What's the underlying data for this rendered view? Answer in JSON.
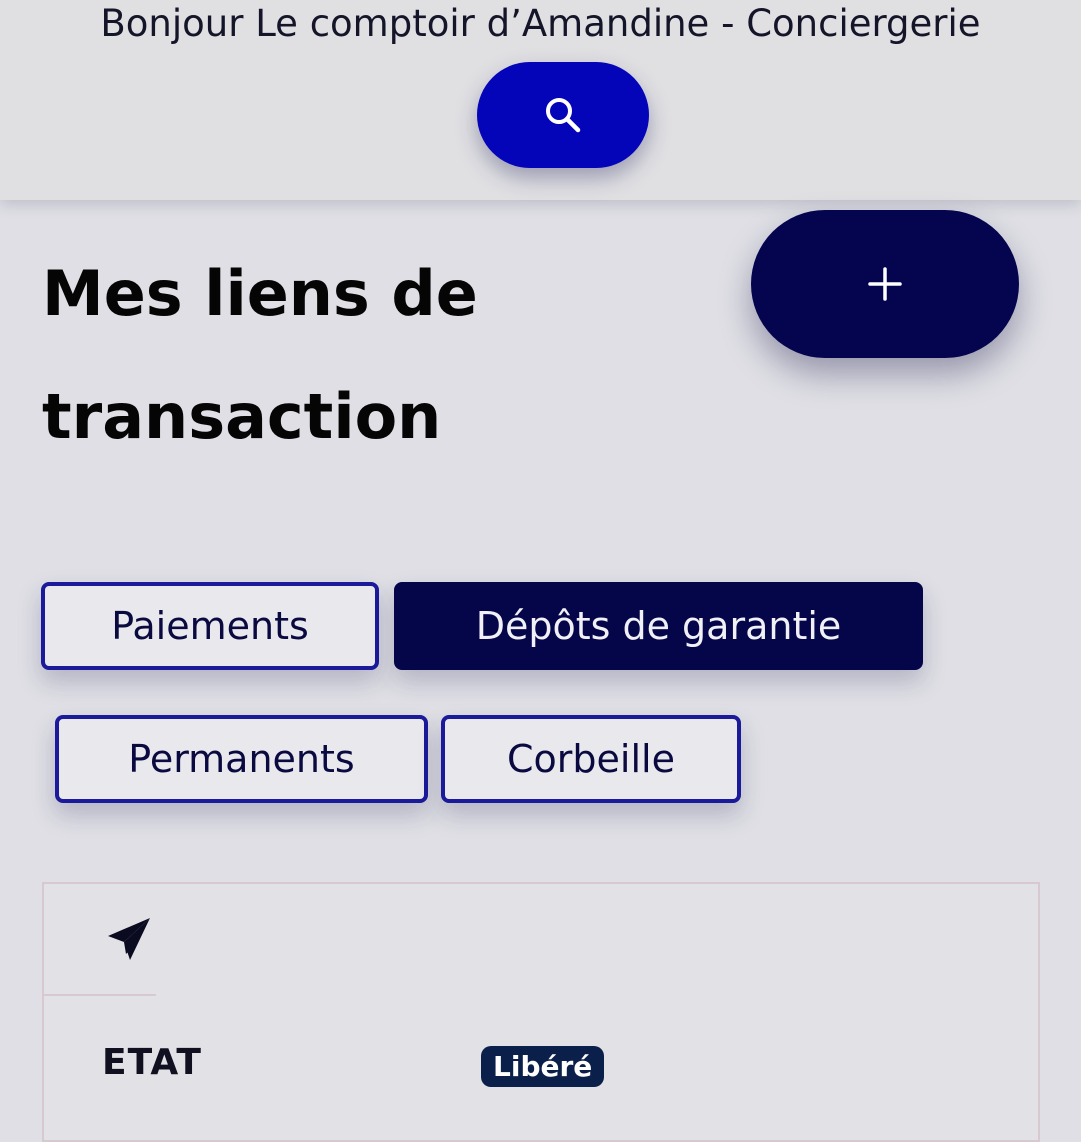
{
  "header": {
    "greeting": "Bonjour Le comptoir d’Amandine - Conciergerie",
    "search_icon": "search-icon",
    "search_color": "#0404b8"
  },
  "page": {
    "title": "Mes liens de transaction",
    "add_icon": "plus-icon",
    "add_color": "#04044f"
  },
  "tabs": [
    {
      "label": "Paiements",
      "active": false
    },
    {
      "label": "Dépôts de garantie",
      "active": true
    },
    {
      "label": "Permanents",
      "active": false
    },
    {
      "label": "Corbeille",
      "active": false
    }
  ],
  "card": {
    "icon": "send-icon",
    "etat_label": "ETAT",
    "status": "Libéré",
    "status_color": "#0a1f4a"
  }
}
